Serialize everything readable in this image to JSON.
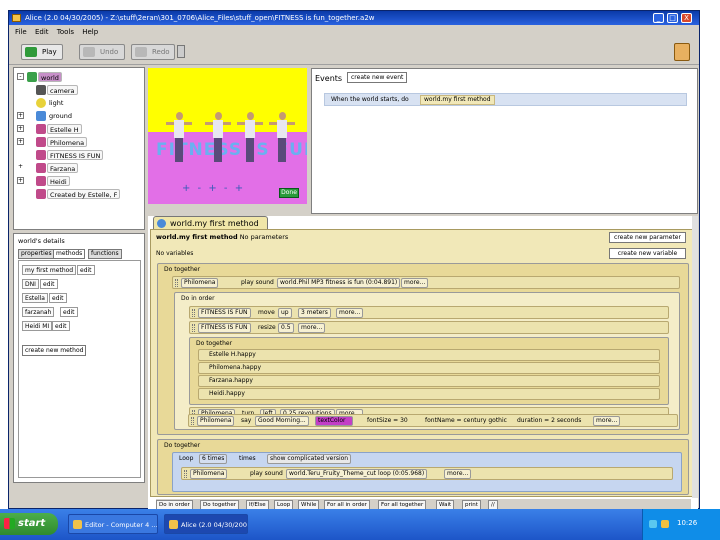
{
  "window": {
    "title": "Alice (2.0 04/30/2005) - Z:\\stuff\\2eran\\301_0706\\Alice_Files\\stuff_open\\FITNESS is fun_together.a2w",
    "controls": [
      "_",
      "□",
      "X"
    ]
  },
  "menu": [
    "File",
    "Edit",
    "Tools",
    "Help"
  ],
  "toolbar": {
    "play": "Play",
    "undo": "Undo",
    "redo": "Redo"
  },
  "tree": {
    "items": [
      {
        "label": "world",
        "expander": "-",
        "selected": true
      },
      {
        "label": "camera",
        "expander": ""
      },
      {
        "label": "light",
        "expander": ""
      },
      {
        "label": "ground",
        "expander": "+"
      },
      {
        "label": "Estelle H",
        "expander": "+"
      },
      {
        "label": "Philomena",
        "expander": "+"
      },
      {
        "label": "FITNESS IS FUN",
        "expander": ""
      },
      {
        "label": "Farzana",
        "expander": "+"
      },
      {
        "label": "Heidi",
        "expander": "+"
      },
      {
        "label": "Created by Estelle, F",
        "expander": ""
      }
    ]
  },
  "scene": {
    "banner": "FITNESS IS FUN",
    "controls": "+ - + - +",
    "done": "Done"
  },
  "events": {
    "title": "Events",
    "create_button": "create new event",
    "when": "When the world starts, do",
    "method": "world.my first method"
  },
  "details": {
    "title": "world's details",
    "tabs": [
      "properties",
      "methods",
      "functions"
    ],
    "methods": [
      {
        "name": "my first method",
        "edit": "edit"
      },
      {
        "name": "DNI",
        "edit": "edit"
      },
      {
        "name": "Estella",
        "edit": "edit"
      },
      {
        "name": "farzanah",
        "edit": "edit"
      },
      {
        "name": "Heidi MI",
        "edit": "edit"
      }
    ],
    "create_method": "create new method"
  },
  "editor": {
    "tab": "world.my first method",
    "header": "world.my first method",
    "no_params": "No parameters",
    "no_vars": "No variables",
    "create_param": "create new parameter",
    "create_var": "create new variable",
    "do_together_1": "Do together",
    "stmt1": {
      "obj": "Philomena",
      "verb": "play sound",
      "arg": "world.Phil MP3 fitness is fun (0:04.891)",
      "more": "more..."
    },
    "do_in_order": "Do in order",
    "stmt2": {
      "obj": "FITNESS IS FUN",
      "verb": "move",
      "dir": "up",
      "amt": "3 meters",
      "more": "more..."
    },
    "stmt3": {
      "obj": "FITNESS IS FUN",
      "verb": "resize",
      "amt": "0.5",
      "more": "more..."
    },
    "do_together_2": "Do together",
    "inner": [
      "Estelle H.happy",
      "Philomena.happy",
      "Farzana.happy",
      "Heidi.happy"
    ],
    "stmt4": {
      "obj": "Philomena",
      "verb": "turn",
      "dir": "left",
      "amt": "0.25 revolutions",
      "more": "more..."
    },
    "stmt5": {
      "obj": "Philomena",
      "verb": "say",
      "text": "Good Morning...",
      "color": "textColor",
      "fontsize": "fontSize = 30",
      "font": "fontName = century gothic",
      "duration": "duration = 2 seconds",
      "more": "more..."
    },
    "do_together_3": "Do together",
    "loop": {
      "label": "Loop",
      "count": "6 times",
      "times": "times",
      "complicated": "show complicated version"
    },
    "stmt6": {
      "obj": "Philomena",
      "verb": "play sound",
      "arg": "world.Teru_Fruity_Theme_cut loop (0:05.968)",
      "more": "more..."
    },
    "bottom": [
      "Do in order",
      "Do together",
      "If/Else",
      "Loop",
      "While",
      "For all in order",
      "For all together",
      "Wait",
      "print",
      "//"
    ]
  },
  "taskbar": {
    "start": "start",
    "tasks": [
      "Editor - Computer 4 ...",
      "Alice (2.0 04/30/2005)..."
    ],
    "clock": "10:26"
  },
  "colors": {
    "titlebar": "#0a3aa8",
    "method_bg": "#f1e8b8",
    "selected_world": "#c78fc8",
    "scene_sky": "#ffff00",
    "scene_ground": "#e26fe7"
  }
}
